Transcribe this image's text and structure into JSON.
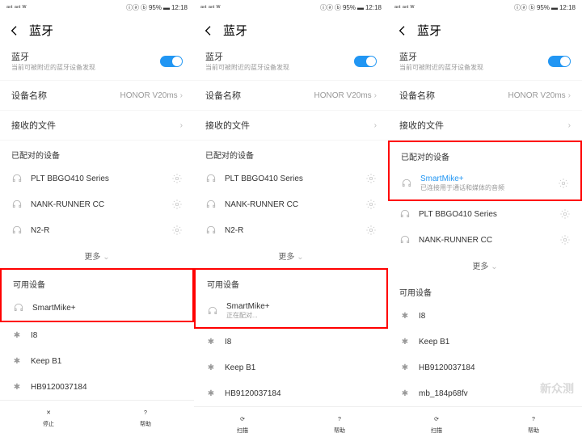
{
  "status": {
    "signal": "ᵃⁿᵗ ᵃⁿᵗ",
    "wifi": "ᵂ",
    "icons": "ⓘⓐ",
    "bt": "ⓑ",
    "battery": "95%",
    "time": "12:18"
  },
  "header": {
    "title": "蓝牙"
  },
  "bt_row": {
    "label": "蓝牙",
    "sub": "当前可被附近的蓝牙设备发现"
  },
  "rows": {
    "device_name": {
      "label": "设备名称",
      "value": "HONOR V20ms"
    },
    "files": {
      "label": "接收的文件"
    }
  },
  "section": {
    "paired": "已配对的设备",
    "available": "可用设备",
    "more": "更多"
  },
  "devices": {
    "plt": "PLT BBGO410 Series",
    "nank": "NANK-RUNNER CC",
    "n2r": "N2-R",
    "smartmike": "SmartMike+",
    "i8": "I8",
    "keepb1": "Keep B1",
    "hb": "HB9120037184",
    "mb": "mb_184p68fv",
    "connected_sub": "已连接用于通话和媒体的音频",
    "pairing": "正在配对..."
  },
  "bottom": {
    "stop": "停止",
    "scan": "扫描",
    "help": "帮助"
  },
  "watermark": "新众测"
}
